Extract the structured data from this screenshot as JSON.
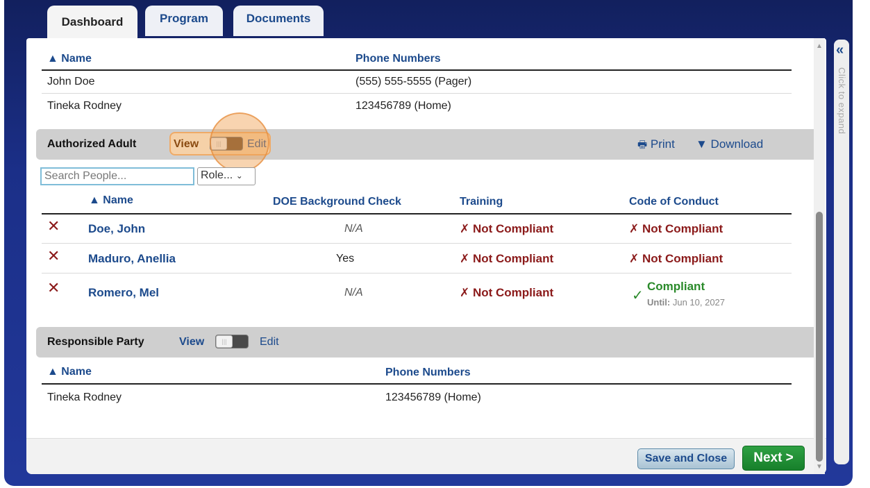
{
  "tabs": [
    {
      "label": "Dashboard"
    },
    {
      "label": "Program"
    },
    {
      "label": "Documents"
    }
  ],
  "top_table": {
    "headers": {
      "name": "▲ Name",
      "phone": "Phone Numbers"
    },
    "rows": [
      {
        "name": "John Doe",
        "phone": "(555) 555-5555 (Pager)"
      },
      {
        "name": "Tineka Rodney",
        "phone": "123456789 (Home)"
      }
    ]
  },
  "authorized_adult": {
    "title": "Authorized Adult",
    "view_label": "View",
    "edit_label": "Edit",
    "print_label": "Print",
    "download_label": "▼ Download",
    "search_placeholder": "Search People...",
    "role_select": "Role...",
    "headers": {
      "name": "▲ Name",
      "doe": "DOE Background Check",
      "training": "Training",
      "code": "Code of Conduct"
    },
    "rows": [
      {
        "name": "Doe, John",
        "doe": "N/A",
        "training": "Not Compliant",
        "code": "Not Compliant"
      },
      {
        "name": "Maduro, Anellia",
        "doe": "Yes",
        "training": "Not Compliant",
        "code": "Not Compliant"
      },
      {
        "name": "Romero, Mel",
        "doe": "N/A",
        "training": "Not Compliant",
        "code": "Compliant",
        "code_until_label": "Until:",
        "code_until_date": "Jun 10, 2027"
      }
    ]
  },
  "responsible_party": {
    "title": "Responsible Party",
    "view_label": "View",
    "edit_label": "Edit",
    "headers": {
      "name": "▲ Name",
      "phone": "Phone Numbers"
    },
    "rows": [
      {
        "name": "Tineka Rodney",
        "phone": "123456789 (Home)"
      }
    ]
  },
  "footer": {
    "save_label": "Save and Close",
    "next_label": "Next >"
  },
  "side_panel": {
    "arrow": "«",
    "text": "Click to expand"
  },
  "colors": {
    "accent": "#1c4a8c",
    "noncompliant": "#8b1a1a",
    "compliant": "#2a8a2a",
    "next_button": "#17802b",
    "frame": "#1b2f88"
  }
}
